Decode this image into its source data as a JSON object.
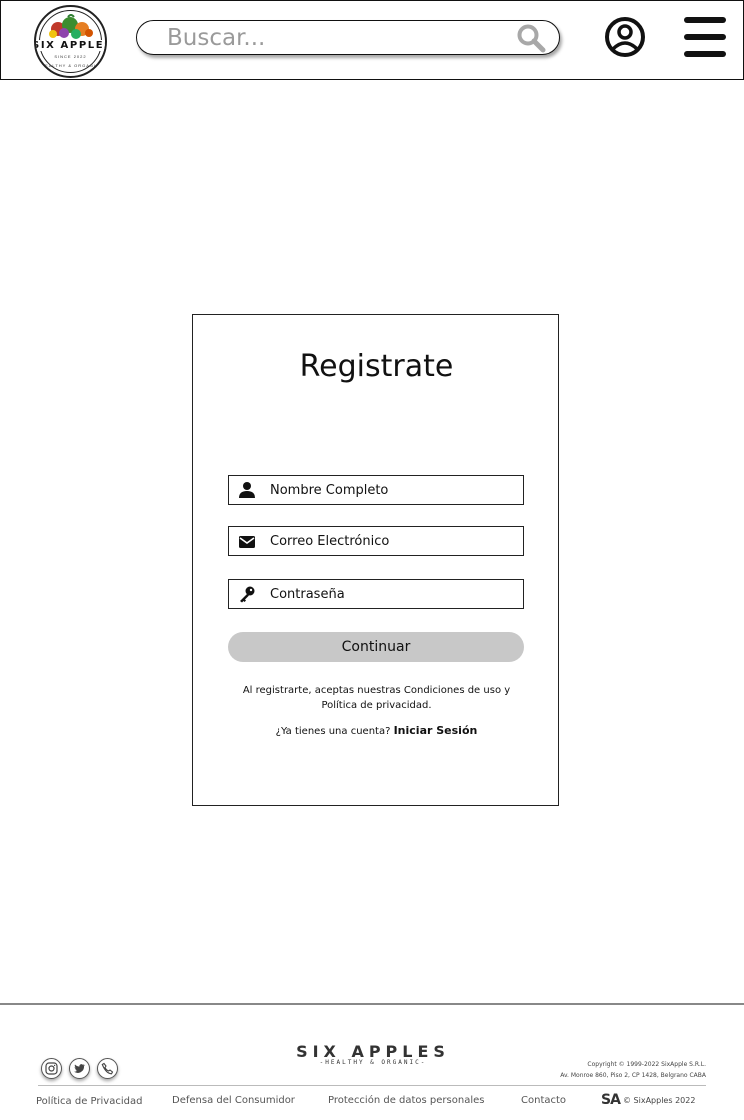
{
  "header": {
    "logo": {
      "name": "SIX APPLES",
      "since": "SINCE 2022",
      "tagline": "HEALTHY & ORGANIC"
    },
    "search": {
      "placeholder": "Buscar...",
      "icon": "search-icon"
    },
    "user_icon": "user-circle-icon",
    "menu_icon": "hamburger-menu-icon"
  },
  "register": {
    "title": "Registrate",
    "fields": [
      {
        "placeholder": "Nombre Completo",
        "icon": "person-icon"
      },
      {
        "placeholder": "Correo Electrónico",
        "icon": "envelope-icon"
      },
      {
        "placeholder": "Contraseña",
        "icon": "key-icon"
      }
    ],
    "continue_label": "Continuar",
    "terms_text": "Al registrarte, aceptas nuestras Condiciones de uso y Política de privacidad.",
    "login_prompt": "¿Ya tienes una cuenta?",
    "login_link": "Iniciar Sesión"
  },
  "footer": {
    "social_icons": [
      "instagram-icon",
      "twitter-icon",
      "phone-icon"
    ],
    "brand": "SIX APPLES",
    "brand_tagline": "-HEALTHY & ORGANIC-",
    "copyright_line1": "Copyright © 1999-2022 SixApple S.R.L.",
    "copyright_line2": "Av. Monroe 860, Piso 2, CP 1428, Belgrano CABA",
    "links": [
      "Política de Privacidad",
      "Defensa del Consumidor",
      "Protección de datos personales",
      "Contacto"
    ],
    "sa_mark": "SA",
    "sa_copyright": "© SixApples 2022"
  },
  "colors": {
    "border": "#222222",
    "button_bg": "#c8c8c8",
    "footer_rule": "#888888",
    "placeholder_gray": "#9a9a9a"
  }
}
